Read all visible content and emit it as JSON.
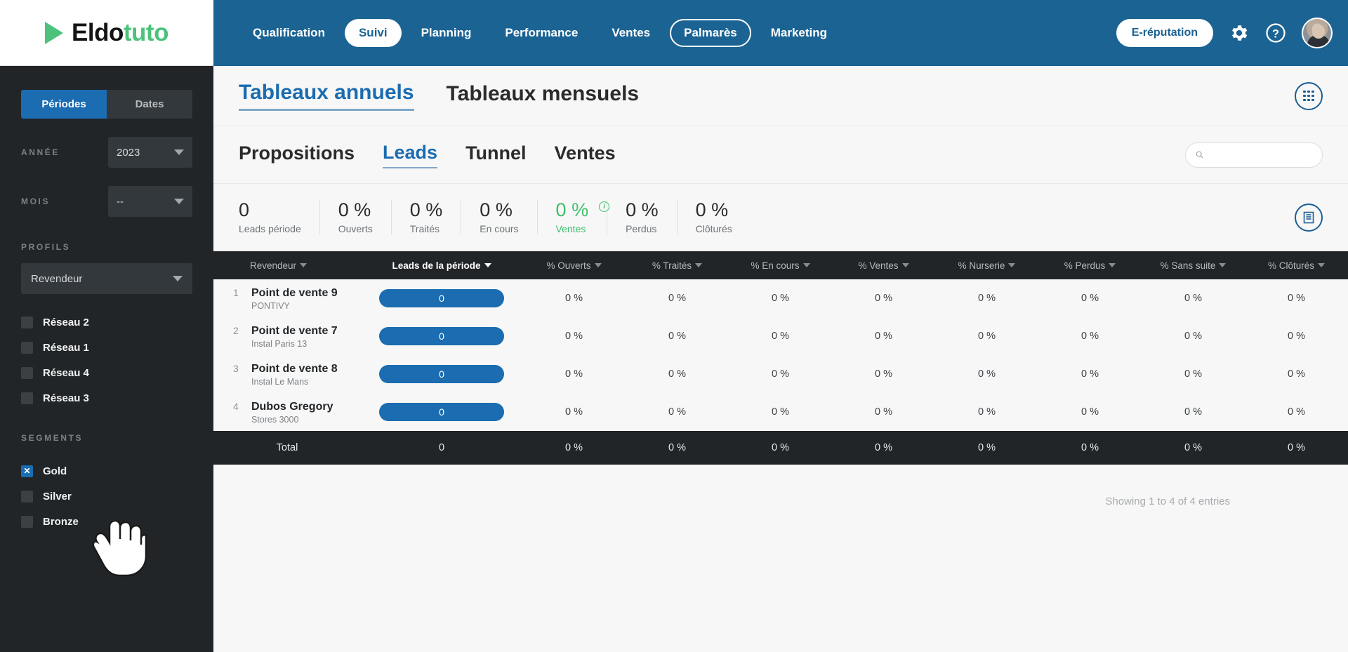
{
  "brand": {
    "name_dark": "Eldo",
    "name_accent": "tuto",
    "accent_color": "#4cc27c",
    "play_icon": "play-triangle-icon"
  },
  "topnav": {
    "items": [
      {
        "label": "Qualification",
        "style": "plain"
      },
      {
        "label": "Suivi",
        "style": "pill-solid"
      },
      {
        "label": "Planning",
        "style": "plain"
      },
      {
        "label": "Performance",
        "style": "plain"
      },
      {
        "label": "Ventes",
        "style": "plain"
      },
      {
        "label": "Palmarès",
        "style": "pill-outline"
      },
      {
        "label": "Marketing",
        "style": "plain"
      }
    ],
    "ereputation_label": "E-réputation",
    "gear_icon": "gear-icon",
    "help_icon": "question-circle-icon",
    "avatar": "user-avatar",
    "bg_color": "#1b6393"
  },
  "sidebar": {
    "tabs": [
      {
        "label": "Périodes",
        "active": true
      },
      {
        "label": "Dates",
        "active": false
      }
    ],
    "annee_label": "ANNÉE",
    "annee_value": "2023",
    "mois_label": "MOIS",
    "mois_value": "--",
    "profils_label": "PROFILS",
    "profil_value": "Revendeur",
    "networks": [
      {
        "label": "Réseau 2",
        "checked": false
      },
      {
        "label": "Réseau 1",
        "checked": false
      },
      {
        "label": "Réseau 4",
        "checked": false
      },
      {
        "label": "Réseau 3",
        "checked": false
      }
    ],
    "segments_label": "SEGMENTS",
    "segments": [
      {
        "label": "Gold",
        "checked": true
      },
      {
        "label": "Silver",
        "checked": false
      },
      {
        "label": "Bronze",
        "checked": false
      }
    ],
    "check_mark": "✕",
    "bg_color": "#212528",
    "active_color": "#1b6cb0"
  },
  "main": {
    "view_tabs": [
      {
        "label": "Tableaux annuels",
        "active": true
      },
      {
        "label": "Tableaux mensuels",
        "active": false
      }
    ],
    "apps_grid_icon": "apps-grid-icon",
    "report_icon": "report-document-icon",
    "sub_tabs": [
      {
        "label": "Propositions",
        "active": false
      },
      {
        "label": "Leads",
        "active": true
      },
      {
        "label": "Tunnel",
        "active": false
      },
      {
        "label": "Ventes",
        "active": false
      }
    ],
    "search": {
      "placeholder": "",
      "value": "",
      "icon": "search-icon"
    },
    "kpis": [
      {
        "value": "0",
        "label": "Leads période",
        "green": false,
        "info": false
      },
      {
        "value": "0 %",
        "label": "Ouverts",
        "green": false,
        "info": false
      },
      {
        "value": "0 %",
        "label": "Traités",
        "green": false,
        "info": false
      },
      {
        "value": "0 %",
        "label": "En cours",
        "green": false,
        "info": false
      },
      {
        "value": "0 %",
        "label": "Ventes",
        "green": true,
        "info": true
      },
      {
        "value": "0 %",
        "label": "Perdus",
        "green": false,
        "info": false
      },
      {
        "value": "0 %",
        "label": "Clôturés",
        "green": false,
        "info": false
      }
    ],
    "table": {
      "columns": [
        {
          "label": "Revendeur",
          "sorted": false
        },
        {
          "label": "Leads de la période",
          "sorted": true
        },
        {
          "label": "% Ouverts",
          "sorted": false
        },
        {
          "label": "% Traités",
          "sorted": false
        },
        {
          "label": "% En cours",
          "sorted": false
        },
        {
          "label": "% Ventes",
          "sorted": false
        },
        {
          "label": "% Nurserie",
          "sorted": false
        },
        {
          "label": "% Perdus",
          "sorted": false
        },
        {
          "label": "% Sans suite",
          "sorted": false
        },
        {
          "label": "% Clôturés",
          "sorted": false
        }
      ],
      "rows": [
        {
          "rank": "1",
          "name": "Point de vente 9",
          "sub": "PONTIVY",
          "leads": "0",
          "values": [
            "0 %",
            "0 %",
            "0 %",
            "0 %",
            "0 %",
            "0 %",
            "0 %",
            "0 %"
          ]
        },
        {
          "rank": "2",
          "name": "Point de vente 7",
          "sub": "Instal Paris 13",
          "leads": "0",
          "values": [
            "0 %",
            "0 %",
            "0 %",
            "0 %",
            "0 %",
            "0 %",
            "0 %",
            "0 %"
          ]
        },
        {
          "rank": "3",
          "name": "Point de vente 8",
          "sub": "Instal Le Mans",
          "leads": "0",
          "values": [
            "0 %",
            "0 %",
            "0 %",
            "0 %",
            "0 %",
            "0 %",
            "0 %",
            "0 %"
          ]
        },
        {
          "rank": "4",
          "name": "Dubos Gregory",
          "sub": "Stores 3000",
          "leads": "0",
          "values": [
            "0 %",
            "0 %",
            "0 %",
            "0 %",
            "0 %",
            "0 %",
            "0 %",
            "0 %"
          ]
        }
      ],
      "total": {
        "label": "Total",
        "leads": "0",
        "values": [
          "0 %",
          "0 %",
          "0 %",
          "0 %",
          "0 %",
          "0 %",
          "0 %",
          "0 %"
        ]
      },
      "bar_color": "#1b6cb0"
    },
    "entries_text": "Showing 1 to 4 of 4 entries"
  },
  "cursor": {
    "type": "pointing-hand-cursor"
  }
}
